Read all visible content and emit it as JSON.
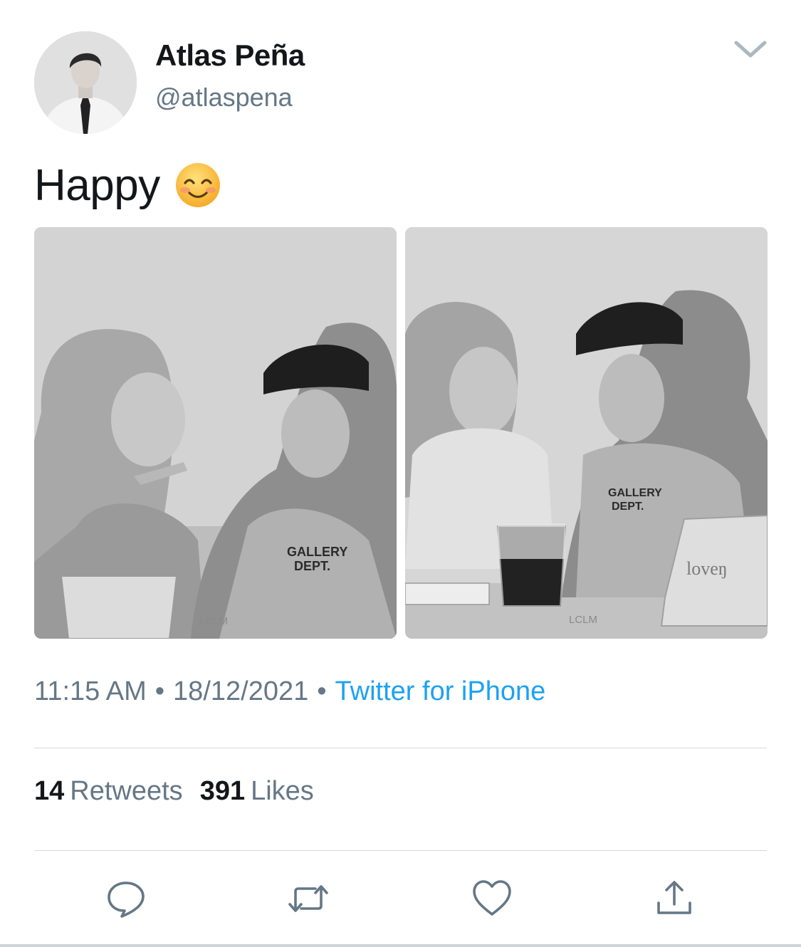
{
  "user": {
    "display_name": "Atlas Peña",
    "handle": "@atlaspena",
    "avatar_icon": "profile-photo"
  },
  "tweet": {
    "text": "Happy",
    "emoji_icon": "smiling-face-with-smiling-eyes-icon",
    "media": [
      {
        "kind": "photo",
        "watermark": "LCLM",
        "shirt_text": [
          "GALLERY",
          "DEPT."
        ]
      },
      {
        "kind": "photo",
        "watermark": "LCLM",
        "shirt_text": [
          "GALLERY",
          "DEPT."
        ],
        "cup_text": "loveŋ"
      }
    ]
  },
  "meta": {
    "time": "11:15 AM",
    "date": "18/12/2021",
    "separator": "•",
    "source": "Twitter for iPhone"
  },
  "stats": {
    "retweets_count": "14",
    "retweets_label": "Retweets",
    "likes_count": "391",
    "likes_label": "Likes"
  },
  "actions": [
    "reply-icon",
    "retweet-icon",
    "like-icon",
    "share-icon"
  ],
  "colors": {
    "text": "#14171a",
    "secondary": "#657786",
    "link": "#1da1f2",
    "divider": "#d4d9de",
    "icon": "#657786"
  }
}
